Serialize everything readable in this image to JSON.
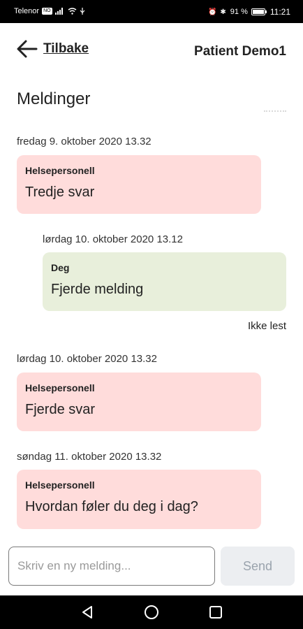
{
  "status_bar": {
    "carrier": "Telenor",
    "carrier_badge": "NO",
    "right_icons": "⏰ ✱",
    "battery": "91 %",
    "time": "11:21"
  },
  "header": {
    "back_label": "Tilbake",
    "patient_name": "Patient Demo1"
  },
  "page": {
    "title": "Meldinger"
  },
  "messages": [
    {
      "timestamp": "fredag 9. oktober 2020 13.32",
      "sender": "Helsepersonell",
      "text": "Tredje svar",
      "type": "staff"
    },
    {
      "timestamp": "lørdag 10. oktober 2020 13.12",
      "sender": "Deg",
      "text": "Fjerde melding",
      "type": "self",
      "status": "Ikke lest"
    },
    {
      "timestamp": "lørdag 10. oktober 2020 13.32",
      "sender": "Helsepersonell",
      "text": "Fjerde svar",
      "type": "staff"
    },
    {
      "timestamp": "søndag 11. oktober 2020 13.32",
      "sender": "Helsepersonell",
      "text": "Hvordan føler du deg i dag?",
      "type": "staff"
    }
  ],
  "composer": {
    "placeholder": "Skriv en ny melding...",
    "send_label": "Send"
  },
  "colors": {
    "staff_bubble": "#ffdcdb",
    "self_bubble": "#e8efdb",
    "send_disabled_bg": "#eceef1"
  }
}
